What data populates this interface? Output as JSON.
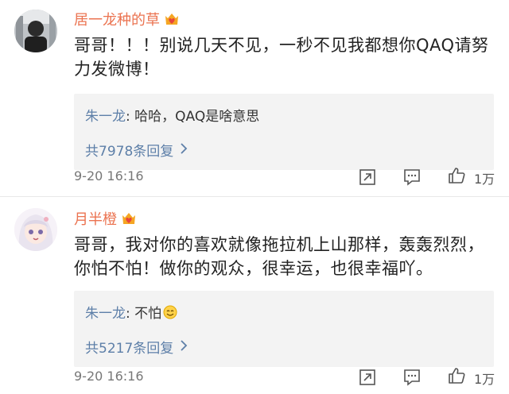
{
  "comments": [
    {
      "username": "居一龙种的草",
      "text": "哥哥！！！别说几天不见，一秒不见我都想你QAQ请努力发微博！",
      "reply": {
        "author": "朱一龙",
        "text": ": 哈哈，QAQ是啥意思",
        "count_label": "共7978条回复"
      },
      "time": "9-20 16:16",
      "likes": "1万"
    },
    {
      "username": "月半橙",
      "text": "哥哥，我对你的喜欢就像拖拉机上山那样，轰轰烈烈，你怕不怕！做你的观众，很幸运，也很幸福吖。",
      "reply": {
        "author": "朱一龙",
        "text": ": 不怕",
        "count_label": "共5217条回复"
      },
      "time": "9-20 16:16",
      "likes": "1万"
    }
  ],
  "icons": {
    "vip": "crown-heart-icon",
    "share": "share-icon",
    "comment": "comment-icon",
    "like": "thumbs-up-icon",
    "chevron": "chevron-right-icon",
    "emoji": "smile-emoji-icon"
  },
  "colors": {
    "username": "#eb7350",
    "link": "#5d7fa8",
    "reply_bg": "#f3f3f3"
  }
}
